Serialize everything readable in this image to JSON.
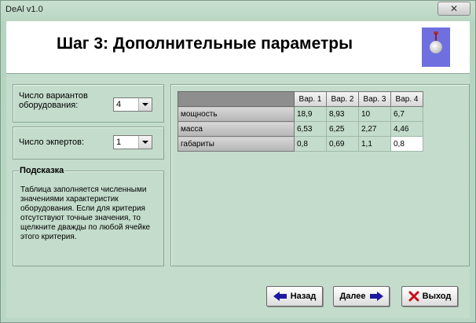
{
  "window": {
    "title": "DeAl v1.0",
    "close_symbol": "✕"
  },
  "header": {
    "title": "Шаг 3: Дополнительные параметры",
    "logo_icon": "ball-pin-logo"
  },
  "variants": {
    "label": "Число вариантов оборудования:",
    "value": "4"
  },
  "experts": {
    "label": "Число экпертов:",
    "value": "1"
  },
  "hint": {
    "title": "Подсказка",
    "text": "Таблица заполняется численными значениями характеристик оборудования. Если для критерия отсутствуют точные значения, то щелкните дважды по любой ячейке этого критерия."
  },
  "grid": {
    "columns": [
      "Вар. 1",
      "Вар. 2",
      "Вар. 3",
      "Вар. 4"
    ],
    "rows": [
      {
        "name": "мощность",
        "values": [
          "18,9",
          "8,93",
          "10",
          "6,7"
        ]
      },
      {
        "name": "масса",
        "values": [
          "6,53",
          "6,25",
          "2,27",
          "4,46"
        ]
      },
      {
        "name": "габариты",
        "values": [
          "0,8",
          "0,69",
          "1,1",
          "0,8"
        ]
      }
    ]
  },
  "buttons": {
    "back": {
      "label": "Назад",
      "icon": "arrow-left-icon"
    },
    "next": {
      "label": "Далее",
      "icon": "arrow-right-icon"
    },
    "exit": {
      "label": "Выход",
      "icon": "red-x-icon"
    }
  },
  "colors": {
    "window_bg": "#c3dccb",
    "accent_blue": "#1a1aa0",
    "exit_red": "#c8101b"
  }
}
